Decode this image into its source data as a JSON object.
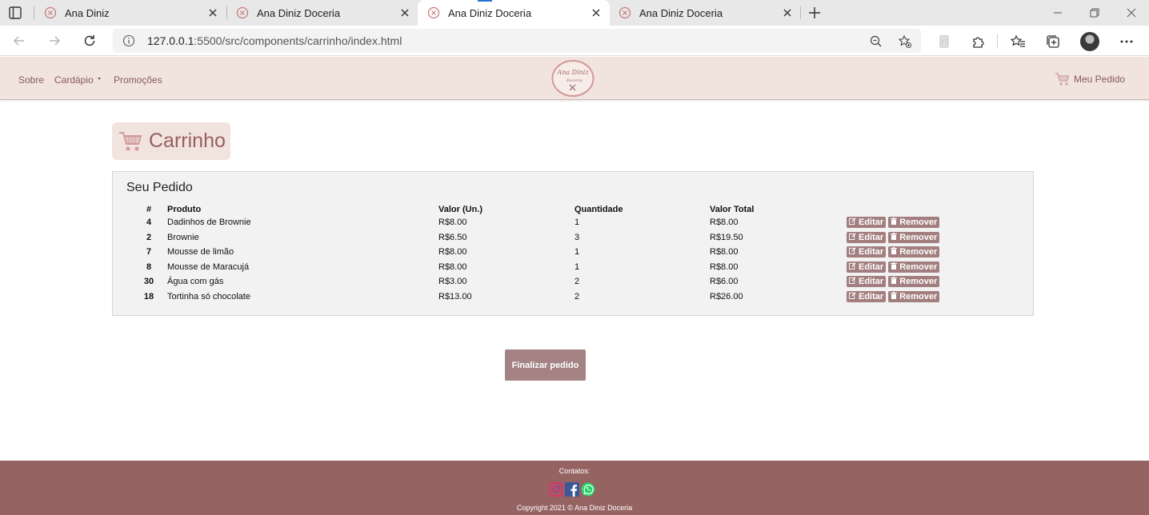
{
  "browser": {
    "tabs": [
      {
        "title": "Ana Diniz",
        "active": false
      },
      {
        "title": "Ana Diniz Doceria",
        "active": false
      },
      {
        "title": "Ana Diniz Doceria",
        "active": true
      },
      {
        "title": "Ana Diniz Doceria",
        "active": false
      }
    ],
    "url_host": "127.0.0.1",
    "url_rest": ":5500/src/components/carrinho/index.html"
  },
  "nav": {
    "sobre": "Sobre",
    "cardapio": "Cardápio",
    "promocoes": "Promoções",
    "meu_pedido": "Meu Pedido",
    "logo_text_1": "Ana Diniz",
    "logo_text_2": "Doceria"
  },
  "page": {
    "title": "Carrinho",
    "panel_title": "Seu Pedido",
    "columns": [
      "#",
      "Produto",
      "Valor (Un.)",
      "Quantidade",
      "Valor Total"
    ],
    "rows": [
      {
        "id": "4",
        "produto": "Dadinhos de Brownie",
        "valor": "R$8.00",
        "qtd": "1",
        "total": "R$8.00"
      },
      {
        "id": "2",
        "produto": "Brownie",
        "valor": "R$6.50",
        "qtd": "3",
        "total": "R$19.50"
      },
      {
        "id": "7",
        "produto": "Mousse de limão",
        "valor": "R$8.00",
        "qtd": "1",
        "total": "R$8.00"
      },
      {
        "id": "8",
        "produto": "Mousse de Maracujá",
        "valor": "R$8.00",
        "qtd": "1",
        "total": "R$8.00"
      },
      {
        "id": "30",
        "produto": "Água com gás",
        "valor": "R$3.00",
        "qtd": "2",
        "total": "R$6.00"
      },
      {
        "id": "18",
        "produto": "Tortinha só chocolate",
        "valor": "R$13.00",
        "qtd": "2",
        "total": "R$26.00"
      }
    ],
    "edit_label": "Editar",
    "remove_label": "Remover",
    "finalizar": "Finalizar pedido"
  },
  "footer": {
    "contatos": "Contatos:",
    "copyright": "Copyright 2021 © Ana Diniz Doceria"
  },
  "colors": {
    "accent": "#966363",
    "nav_bg": "#f1e3de",
    "button": "#a58384"
  }
}
